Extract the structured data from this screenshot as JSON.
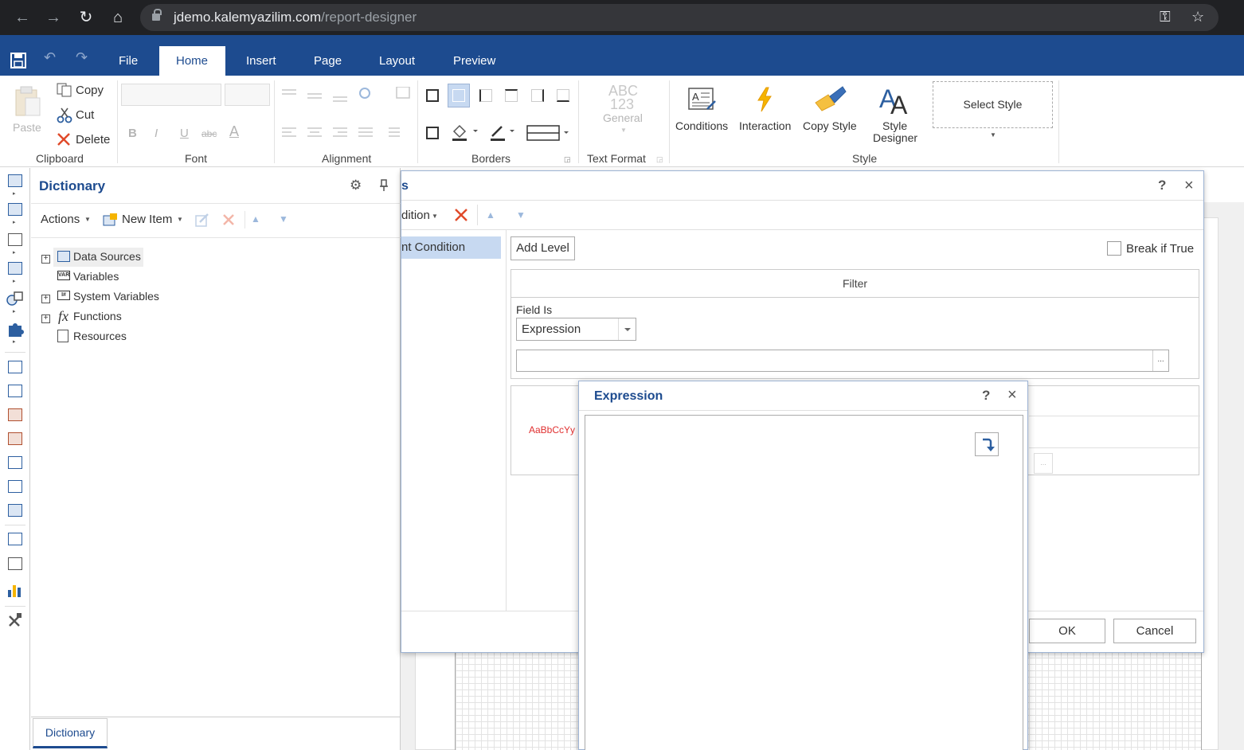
{
  "browser": {
    "url_host": "jdemo.kalemyazilim.com",
    "url_path": "/report-designer"
  },
  "appbar": {
    "tabs": [
      "File",
      "Home",
      "Insert",
      "Page",
      "Layout",
      "Preview"
    ],
    "active_tab": "Home"
  },
  "ribbon": {
    "clipboard": {
      "paste": "Paste",
      "copy": "Copy",
      "cut": "Cut",
      "delete": "Delete",
      "label": "Clipboard"
    },
    "font": {
      "label": "Font",
      "bold": "B",
      "italic": "I",
      "underline": "U",
      "strike": "abc"
    },
    "alignment": {
      "label": "Alignment"
    },
    "borders": {
      "label": "Borders"
    },
    "text_format": {
      "abc": "ABC",
      "num": "123",
      "general": "General",
      "label": "Text Format"
    },
    "style": {
      "conditions": "Conditions",
      "interaction": "Interaction",
      "copy_style": "Copy Style",
      "style_designer_1": "Style",
      "style_designer_2": "Designer",
      "select_style": "Select Style",
      "label": "Style"
    }
  },
  "dictionary": {
    "title": "Dictionary",
    "actions": "Actions",
    "new_item": "New Item",
    "tree": [
      "Data Sources",
      "Variables",
      "System Variables",
      "Functions",
      "Resources"
    ],
    "bottom_tab": "Dictionary"
  },
  "conditions_dialog": {
    "title_fragment": "s",
    "toolbar_fragment": "dition",
    "list_item_fragment": "nt Condition",
    "add_level": "Add Level",
    "break_if_true": "Break if True",
    "filter_header": "Filter",
    "field_is_label": "Field Is",
    "field_is_value": "Expression",
    "expression_value": "",
    "ellipsis": "...",
    "sample_text": "AaBbCcYy",
    "ok": "OK",
    "cancel": "Cancel"
  },
  "expression_dialog": {
    "title": "Expression",
    "help": "?",
    "close": "×",
    "value": ""
  },
  "colors": {
    "brand_blue": "#1d4b8f",
    "selection": "#c7d9f1",
    "sample_red": "#e03030"
  }
}
